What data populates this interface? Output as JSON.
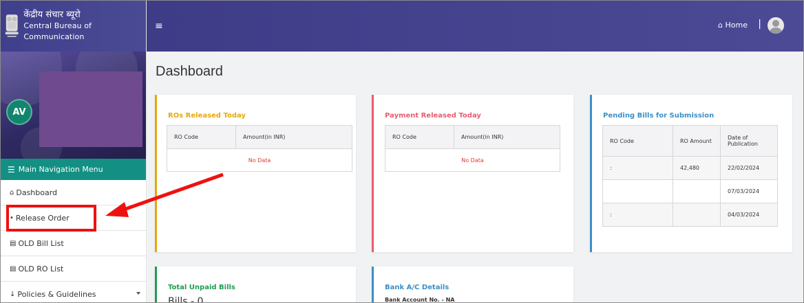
{
  "brand": {
    "hindi": "केंद्रीय संचार ब्यूरो",
    "english": "Central Bureau of Communication"
  },
  "profile": {
    "initials": "AV"
  },
  "nav": {
    "header": "Main Navigation Menu",
    "items": [
      {
        "label": "Dashboard",
        "icon": "home-icon"
      },
      {
        "label": "Release Order",
        "icon": "bullet-icon"
      },
      {
        "label": "OLD Bill List",
        "icon": "list-icon"
      },
      {
        "label": "OLD RO List",
        "icon": "list-icon"
      },
      {
        "label": "Policies & Guidelines",
        "icon": "download-icon"
      }
    ]
  },
  "topbar": {
    "home_label": "Home",
    "separator": "|"
  },
  "page": {
    "title": "Dashboard"
  },
  "cards": {
    "ros_released": {
      "title": "ROs Released Today",
      "color": "#e6a90c",
      "columns": [
        "RO Code",
        "Amount(in INR)"
      ],
      "empty_text": "No Data"
    },
    "payment_released": {
      "title": "Payment Released Today",
      "color": "#e85d6f",
      "columns": [
        "RO Code",
        "Amount(in INR)"
      ],
      "empty_text": "No Data"
    },
    "pending_bills": {
      "title": "Pending Bills for Submission",
      "color": "#3a8fc8",
      "columns": [
        "RO Code",
        "RO Amount",
        "Date of Publication"
      ],
      "rows": [
        {
          "code": ":",
          "amount": "42,480",
          "date": "22/02/2024"
        },
        {
          "code": "",
          "amount": "",
          "date": "07/03/2024"
        },
        {
          "code": ":",
          "amount": "",
          "date": "04/03/2024"
        }
      ]
    },
    "unpaid_bills": {
      "title": "Total Unpaid Bills",
      "color": "#1e9c4f",
      "line": "Bills - 0"
    },
    "bank": {
      "title": "Bank A/C Details",
      "color": "#3a8fc8",
      "account": "Bank Account No. - NA"
    }
  },
  "colors": {
    "topbar": "#4a4892",
    "nav_header": "#139083",
    "annotation": "#ee1111"
  }
}
